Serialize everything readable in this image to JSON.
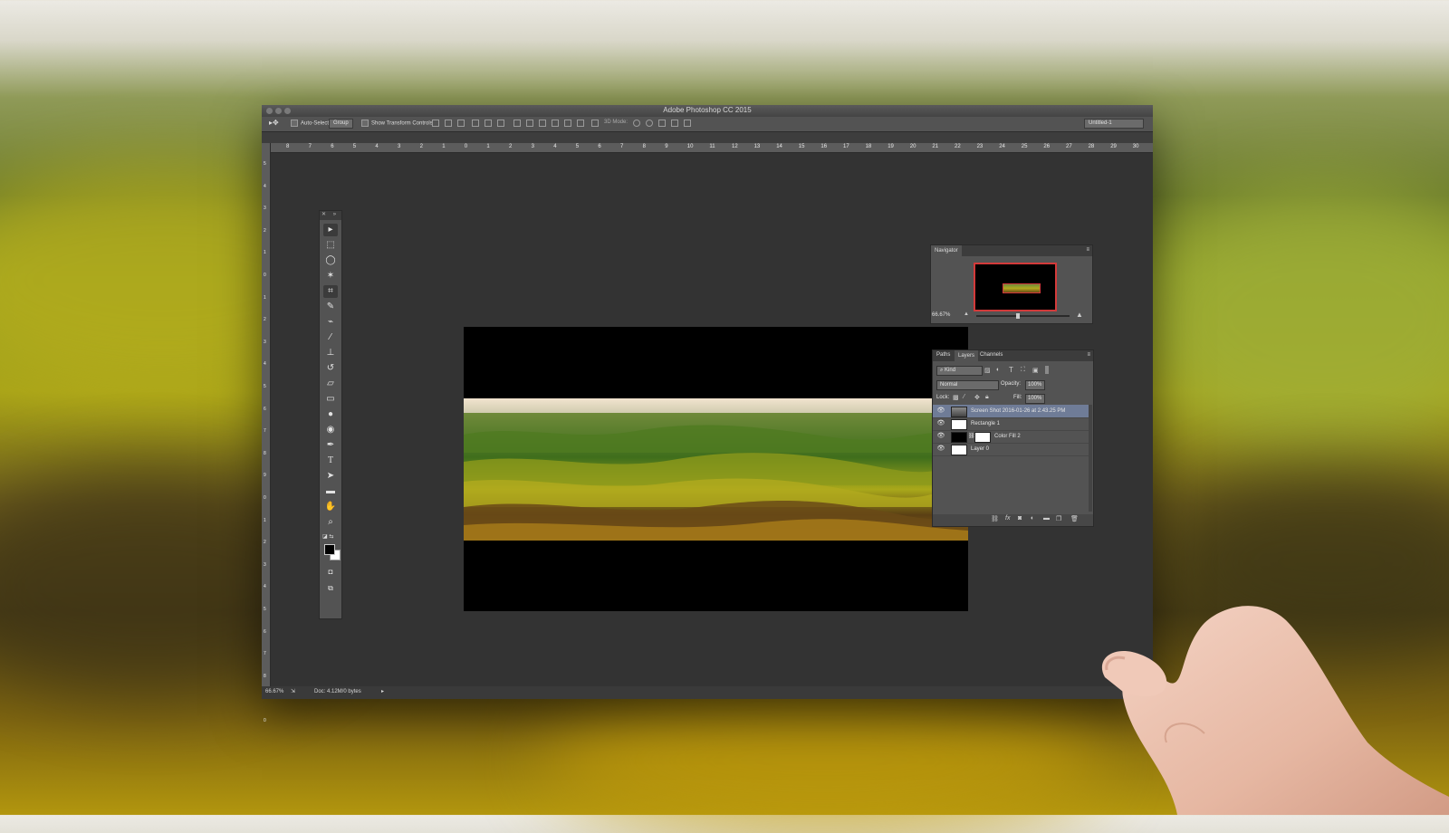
{
  "window": {
    "title": "Adobe Photoshop CC 2015"
  },
  "options_bar": {
    "auto_select_label": "Auto-Select:",
    "auto_select_value": "Group",
    "show_transform_label": "Show Transform Controls",
    "mode_3d_label": "3D Mode:",
    "workspace_value": "Untitled-1"
  },
  "ruler": {
    "top_ticks": [
      "8",
      "7",
      "6",
      "5",
      "4",
      "3",
      "2",
      "1",
      "0",
      "1",
      "2",
      "3",
      "4",
      "5",
      "6",
      "7",
      "8",
      "9",
      "10",
      "11",
      "12",
      "13",
      "14",
      "15",
      "16",
      "17",
      "18",
      "19",
      "20",
      "21",
      "22",
      "23",
      "24",
      "25",
      "26",
      "27",
      "28",
      "29",
      "30"
    ],
    "left_ticks": [
      "5",
      "4",
      "3",
      "2",
      "1",
      "0",
      "1",
      "2",
      "3",
      "4",
      "5",
      "6",
      "7",
      "8",
      "9",
      "0",
      "1",
      "2",
      "3",
      "4",
      "5",
      "6",
      "7",
      "8",
      "9",
      "0"
    ]
  },
  "navigator": {
    "title": "Navigator",
    "zoom": "66.67%"
  },
  "layers_panel": {
    "tabs": [
      "Paths",
      "Layers",
      "Channels"
    ],
    "kind_label": "Kind",
    "blend_mode": "Normal",
    "opacity_label": "Opacity:",
    "opacity_value": "100%",
    "lock_label": "Lock:",
    "fill_label": "Fill:",
    "fill_value": "100%",
    "layers": [
      {
        "name": "Screen Shot 2016-01-26 at 2.43.25 PM",
        "selected": true
      },
      {
        "name": "Rectangle 1",
        "selected": false
      },
      {
        "name": "Color Fill 2",
        "selected": false
      },
      {
        "name": "Layer 0",
        "selected": false
      }
    ]
  },
  "status_bar": {
    "zoom": "66.67%",
    "doc_info": "Doc: 4.12M/0 bytes"
  },
  "colors": {
    "workspace": "#323232",
    "panel": "#535353",
    "selection": "#6f7c97"
  }
}
